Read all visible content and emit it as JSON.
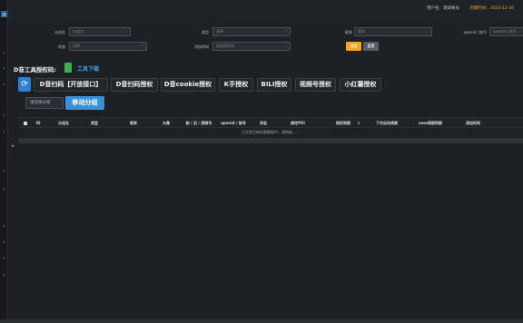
{
  "topbar": {
    "user_text": "用户名：测试帐号",
    "expire_text": "到期时间：2024-12-26"
  },
  "filter": {
    "nickname_label": "分组名",
    "nickname_placeholder": "分组名",
    "select1_label": "类型",
    "select1_value": "选择",
    "account_label": "昵称",
    "account_placeholder": "昵称",
    "openid_label": "openid / 账号",
    "openid_placeholder": "openid / 账号",
    "status_label": "状态",
    "status_value": "选择",
    "date_label": "添加时间",
    "date_placeholder": "请选择时间",
    "search_label": "搜索",
    "reset_label": "重置"
  },
  "tools": {
    "title": "D音工具授权码:",
    "download": "工具下载"
  },
  "actions": {
    "refresh_icon": "refresh-icon",
    "buttons": [
      "D音扫码【开放接口】",
      "D音扫码授权",
      "D音cookie授权",
      "K手授权",
      "BILI授权",
      "视频号授权",
      "小红薯授权"
    ]
  },
  "group": {
    "select_value": "请选择分组",
    "move_label": "移动分组"
  },
  "table": {
    "headers": [
      "ID",
      "分组名",
      "类型",
      "昵称",
      "头像",
      "新 / 旧 / 视频号",
      "openid / 账号",
      "状态",
      "绑定POI",
      "授权到期",
      "下次自动续期",
      "sess续期到期",
      "添加时间"
    ],
    "loading_text": "正在努力地加载数据中，请稍候……"
  }
}
